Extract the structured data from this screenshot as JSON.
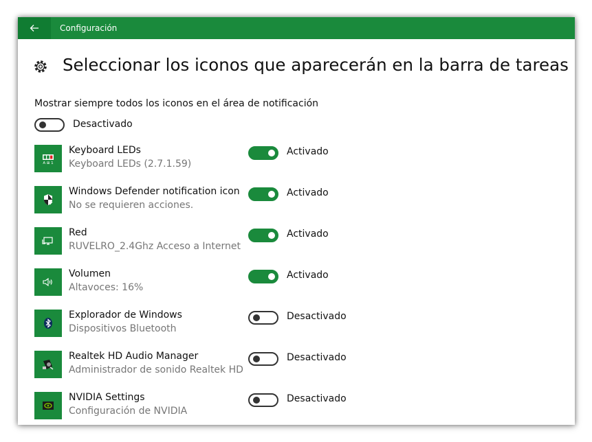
{
  "window": {
    "title": "Configuración"
  },
  "page": {
    "title": "Seleccionar los iconos que aparecerán en la barra de tareas",
    "always_show_label": "Mostrar siempre todos los iconos en el área de notificación",
    "always_show_state": "Desactivado",
    "always_show_on": false
  },
  "apps": [
    {
      "name": "Keyboard LEDs",
      "description": "Keyboard LEDs (2.7.1.59)",
      "state": "Activado",
      "on": true,
      "icon": "keyboard-leds-icon"
    },
    {
      "name": "Windows Defender notification icon",
      "description": "No se requieren acciones.",
      "state": "Activado",
      "on": true,
      "icon": "defender-shield-icon"
    },
    {
      "name": "Red",
      "description": "RUVELRO_2.4Ghz Acceso a Internet",
      "state": "Activado",
      "on": true,
      "icon": "network-icon"
    },
    {
      "name": "Volumen",
      "description": "Altavoces: 16%",
      "state": "Activado",
      "on": true,
      "icon": "speaker-icon"
    },
    {
      "name": "Explorador de Windows",
      "description": "Dispositivos Bluetooth",
      "state": "Desactivado",
      "on": false,
      "icon": "bluetooth-icon"
    },
    {
      "name": "Realtek HD Audio Manager",
      "description": "Administrador de sonido Realtek HD",
      "state": "Desactivado",
      "on": false,
      "icon": "realtek-audio-icon"
    },
    {
      "name": "NVIDIA Settings",
      "description": "Configuración de NVIDIA",
      "state": "Desactivado",
      "on": false,
      "icon": "nvidia-icon"
    }
  ],
  "colors": {
    "accent": "#1a8a3c",
    "accent_dark": "#107c32",
    "secondary_text": "#767676"
  }
}
